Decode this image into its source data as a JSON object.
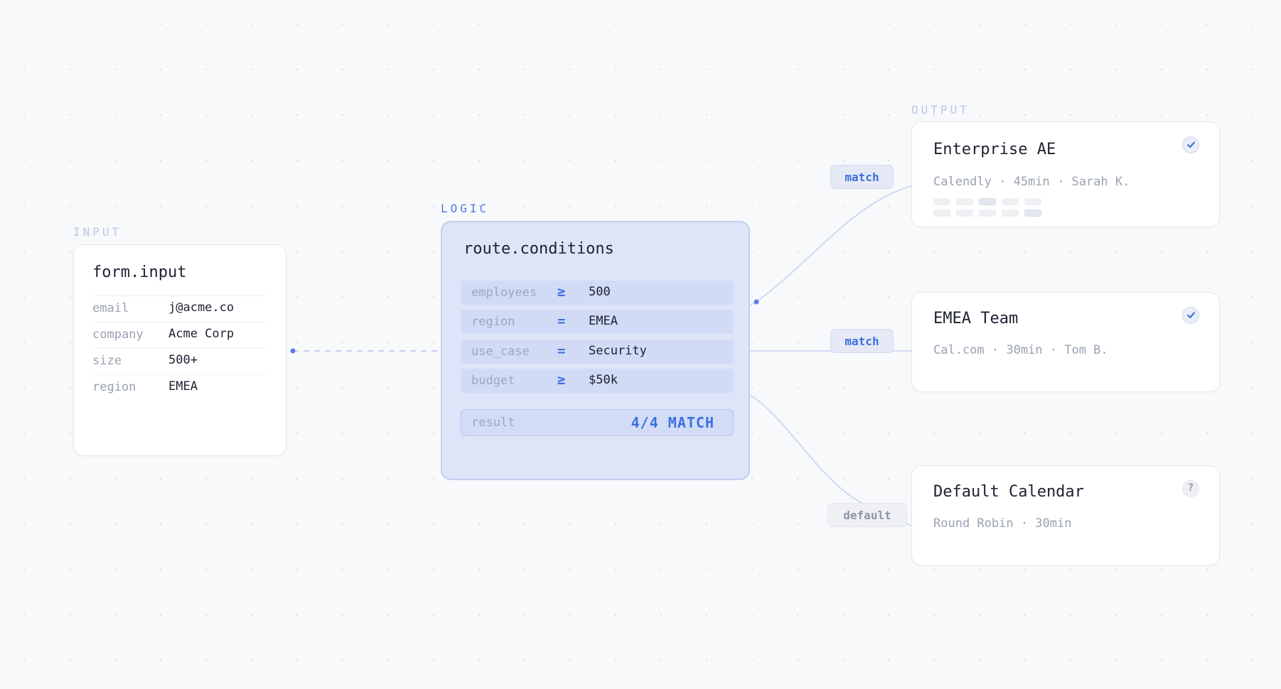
{
  "sections": {
    "input": "INPUT",
    "logic": "LOGIC",
    "output": "OUTPUT"
  },
  "colors": {
    "accent": "#3d6fe0",
    "background": "#f8f9fb",
    "logic_fill": "#dfe5f8",
    "edge": "#c8d2f2"
  },
  "input_card": {
    "title": "form.input",
    "fields": [
      {
        "key": "email",
        "value": "j@acme.co"
      },
      {
        "key": "company",
        "value": "Acme Corp"
      },
      {
        "key": "size",
        "value": "500+"
      },
      {
        "key": "region",
        "value": "EMEA"
      }
    ]
  },
  "logic_card": {
    "title": "route.conditions",
    "conditions": [
      {
        "field": "employees",
        "op": "≥",
        "value": "500"
      },
      {
        "field": "region",
        "op": "=",
        "value": "EMEA"
      },
      {
        "field": "use_case",
        "op": "=",
        "value": "Security"
      },
      {
        "field": "budget",
        "op": "≥",
        "value": "$50k"
      }
    ],
    "result_label": "result",
    "result_value": "4/4 MATCH"
  },
  "edges": {
    "enterprise": "match",
    "emea": "match",
    "default": "default"
  },
  "outputs": [
    {
      "title": "Enterprise AE",
      "meta": "Calendly · 45min · Sarah K.",
      "status_icon": "check-icon"
    },
    {
      "title": "EMEA Team",
      "meta": "Cal.com · 30min · Tom B.",
      "status_icon": "check-icon"
    },
    {
      "title": "Default Calendar",
      "meta": "Round Robin · 30min",
      "status_icon": "question-icon",
      "status_text": "?"
    }
  ]
}
